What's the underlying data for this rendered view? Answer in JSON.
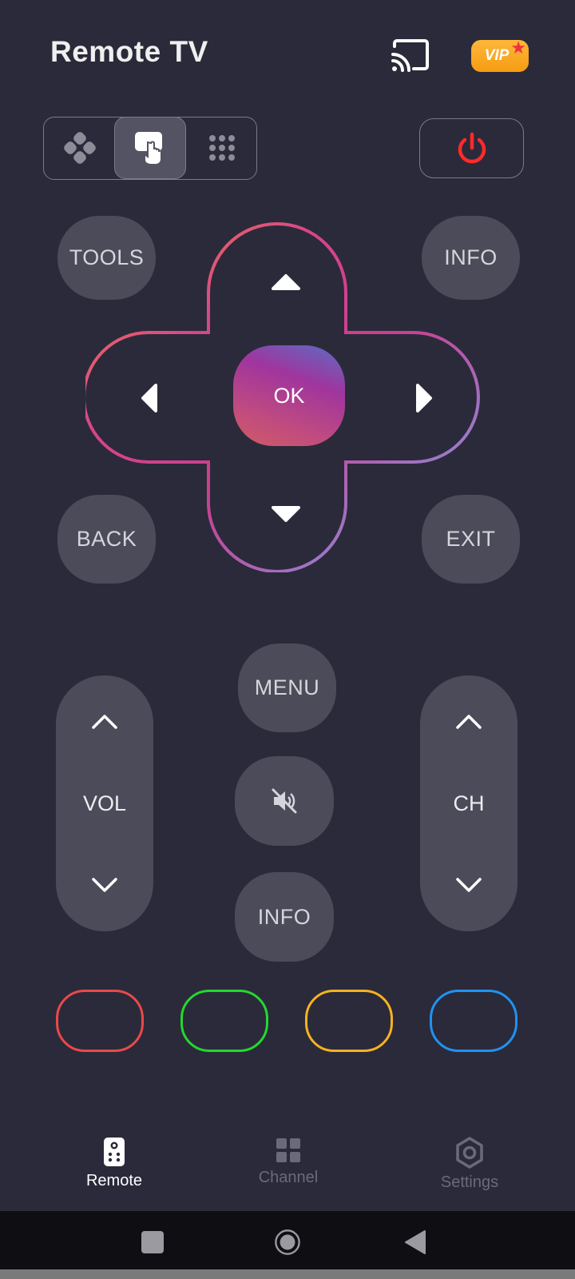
{
  "header": {
    "title": "Remote TV",
    "vip_label": "VIP",
    "cast_icon": "cast-icon",
    "vip_star_icon": "star-icon"
  },
  "mode_selector": {
    "modes": [
      {
        "name": "gamepad",
        "icon": "gamepad-icon",
        "active": false
      },
      {
        "name": "touchpad",
        "icon": "touchpad-icon",
        "active": true
      },
      {
        "name": "numpad",
        "icon": "numpad-icon",
        "active": false
      }
    ]
  },
  "power": {
    "icon": "power-icon",
    "color": "#ff2a2a"
  },
  "side_buttons": {
    "tools": "TOOLS",
    "info_top": "INFO",
    "back": "BACK",
    "exit": "EXIT"
  },
  "dpad": {
    "ok": "OK",
    "up_icon": "arrow-up-icon",
    "down_icon": "arrow-down-icon",
    "left_icon": "arrow-left-icon",
    "right_icon": "arrow-right-icon"
  },
  "center_column": {
    "menu": "MENU",
    "mute_icon": "mute-icon",
    "info": "INFO"
  },
  "volume": {
    "label": "VOL",
    "up_icon": "chevron-up-icon",
    "down_icon": "chevron-down-icon"
  },
  "channel": {
    "label": "CH",
    "up_icon": "chevron-up-icon",
    "down_icon": "chevron-down-icon"
  },
  "color_buttons": [
    {
      "name": "red",
      "color": "#e84a4a"
    },
    {
      "name": "green",
      "color": "#22d92e"
    },
    {
      "name": "yellow",
      "color": "#f7b21f"
    },
    {
      "name": "blue",
      "color": "#1f93f2"
    }
  ],
  "bottom_nav": {
    "items": [
      {
        "label": "Remote",
        "icon": "remote-icon",
        "active": true
      },
      {
        "label": "Channel",
        "icon": "grid-icon",
        "active": false
      },
      {
        "label": "Settings",
        "icon": "settings-icon",
        "active": false
      }
    ]
  },
  "system_nav": {
    "recents_icon": "square-icon",
    "home_icon": "circle-icon",
    "back_icon": "triangle-back-icon"
  }
}
